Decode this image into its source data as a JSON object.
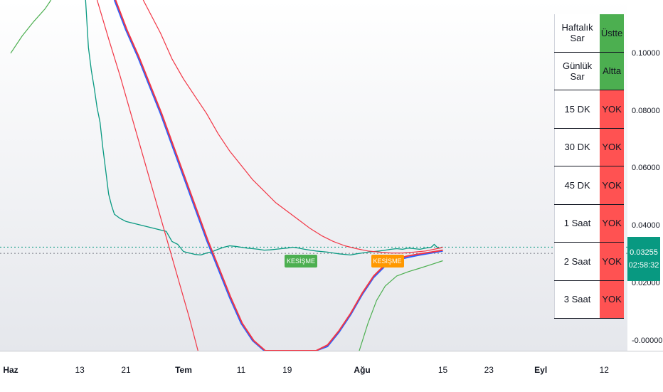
{
  "chart_data": {
    "type": "line",
    "y_ticks": [
      "0.10000",
      "0.08000",
      "0.06000",
      "0.04000",
      "0.02000",
      "-0.00000"
    ],
    "y_tick_values": [
      0.1,
      0.08,
      0.06,
      0.04,
      0.02,
      0.0
    ],
    "ylim": [
      -0.0035,
      0.1185
    ],
    "x_ticks": [
      {
        "label": "Haz",
        "day": 0,
        "major": true
      },
      {
        "label": "13",
        "day": 12,
        "major": false
      },
      {
        "label": "21",
        "day": 20,
        "major": false
      },
      {
        "label": "Tem",
        "day": 30,
        "major": true
      },
      {
        "label": "11",
        "day": 40,
        "major": false
      },
      {
        "label": "19",
        "day": 48,
        "major": false
      },
      {
        "label": "Ağu",
        "day": 61,
        "major": true
      },
      {
        "label": "15",
        "day": 75,
        "major": false
      },
      {
        "label": "23",
        "day": 83,
        "major": false
      },
      {
        "label": "Eyl",
        "day": 92,
        "major": true
      },
      {
        "label": "12",
        "day": 103,
        "major": false
      }
    ],
    "last_price": "0.03255",
    "countdown": "02:58:32",
    "grid": false,
    "series": [
      {
        "color": "#089981",
        "role": "price",
        "points": [
          [
            13,
            0.1185
          ],
          [
            13.5,
            0.102
          ],
          [
            14,
            0.094
          ],
          [
            14.5,
            0.088
          ],
          [
            15,
            0.081
          ],
          [
            15.5,
            0.076
          ],
          [
            16,
            0.067
          ],
          [
            16.5,
            0.059
          ],
          [
            17,
            0.051
          ],
          [
            17.5,
            0.047
          ],
          [
            18,
            0.044
          ],
          [
            19,
            0.0425
          ],
          [
            20,
            0.0415
          ],
          [
            21,
            0.041
          ],
          [
            22,
            0.0405
          ],
          [
            23,
            0.04
          ],
          [
            24,
            0.0395
          ],
          [
            25,
            0.039
          ],
          [
            26,
            0.0385
          ],
          [
            27,
            0.038
          ],
          [
            28,
            0.0345
          ],
          [
            29,
            0.0335
          ],
          [
            30,
            0.031
          ],
          [
            31,
            0.0305
          ],
          [
            32,
            0.03
          ],
          [
            33,
            0.0298
          ],
          [
            34,
            0.0305
          ],
          [
            35,
            0.031
          ],
          [
            36,
            0.0318
          ],
          [
            37,
            0.0325
          ],
          [
            38,
            0.033
          ],
          [
            39,
            0.0328
          ],
          [
            40,
            0.0325
          ],
          [
            41,
            0.0322
          ],
          [
            42,
            0.032
          ],
          [
            43,
            0.0318
          ],
          [
            44,
            0.0315
          ],
          [
            45,
            0.0316
          ],
          [
            46,
            0.0318
          ],
          [
            47,
            0.032
          ],
          [
            48,
            0.0322
          ],
          [
            49,
            0.0325
          ],
          [
            50,
            0.0322
          ],
          [
            51,
            0.0318
          ],
          [
            52,
            0.0315
          ],
          [
            53,
            0.0312
          ],
          [
            54,
            0.031
          ],
          [
            55,
            0.0308
          ],
          [
            56,
            0.0305
          ],
          [
            57,
            0.0302
          ],
          [
            58,
            0.03
          ],
          [
            59,
            0.0298
          ],
          [
            60,
            0.0302
          ],
          [
            61,
            0.0305
          ],
          [
            62,
            0.0308
          ],
          [
            63,
            0.031
          ],
          [
            64,
            0.0312
          ],
          [
            65,
            0.0315
          ],
          [
            66,
            0.0318
          ],
          [
            67,
            0.032
          ],
          [
            68,
            0.0318
          ],
          [
            69,
            0.0322
          ],
          [
            70,
            0.032
          ],
          [
            71,
            0.0318
          ],
          [
            72,
            0.0322
          ],
          [
            73,
            0.0325
          ],
          [
            73.5,
            0.0335
          ],
          [
            74,
            0.0325
          ],
          [
            74.5,
            0.0322
          ],
          [
            75,
            0.03255
          ]
        ]
      },
      {
        "color": "#f23645",
        "role": "ma-slow",
        "points": [
          [
            23,
            0.1185
          ],
          [
            26,
            0.107
          ],
          [
            28,
            0.098
          ],
          [
            30,
            0.091
          ],
          [
            32,
            0.085
          ],
          [
            34,
            0.079
          ],
          [
            36,
            0.072
          ],
          [
            38,
            0.066
          ],
          [
            40,
            0.061
          ],
          [
            42,
            0.056
          ],
          [
            44,
            0.052
          ],
          [
            46,
            0.048
          ],
          [
            48,
            0.045
          ],
          [
            50,
            0.042
          ],
          [
            52,
            0.039
          ],
          [
            54,
            0.0365
          ],
          [
            56,
            0.0345
          ],
          [
            58,
            0.033
          ],
          [
            60,
            0.032
          ],
          [
            62,
            0.0312
          ],
          [
            64,
            0.0308
          ],
          [
            66,
            0.0305
          ],
          [
            68,
            0.0305
          ],
          [
            70,
            0.0308
          ],
          [
            72,
            0.0312
          ],
          [
            74,
            0.032
          ],
          [
            75,
            0.0325
          ]
        ]
      },
      {
        "color": "#2962ff",
        "role": "ma-fast",
        "points": [
          [
            18,
            0.1185
          ],
          [
            20,
            0.108
          ],
          [
            22,
            0.099
          ],
          [
            24,
            0.089
          ],
          [
            26,
            0.079
          ],
          [
            28,
            0.068
          ],
          [
            30,
            0.057
          ],
          [
            32,
            0.046
          ],
          [
            34,
            0.035
          ],
          [
            36,
            0.025
          ],
          [
            38,
            0.015
          ],
          [
            40,
            0.006
          ],
          [
            42,
            0.0
          ],
          [
            44,
            -0.0035
          ],
          [
            53,
            -0.0035
          ],
          [
            55,
            -0.002
          ],
          [
            57,
            0.003
          ],
          [
            59,
            0.009
          ],
          [
            61,
            0.016
          ],
          [
            63,
            0.022
          ],
          [
            65,
            0.026
          ],
          [
            67,
            0.028
          ],
          [
            69,
            0.029
          ],
          [
            71,
            0.0298
          ],
          [
            73,
            0.0305
          ],
          [
            75,
            0.0312
          ]
        ]
      },
      {
        "color": "#f23645",
        "role": "ma-fast-2",
        "points": [
          [
            18.2,
            0.1185
          ],
          [
            20.2,
            0.108
          ],
          [
            22.2,
            0.099
          ],
          [
            24.2,
            0.089
          ],
          [
            26.2,
            0.079
          ],
          [
            28.2,
            0.068
          ],
          [
            30.2,
            0.057
          ],
          [
            32.2,
            0.046
          ],
          [
            34.2,
            0.035
          ],
          [
            36.2,
            0.025
          ],
          [
            38.2,
            0.015
          ],
          [
            40.2,
            0.006
          ],
          [
            42.2,
            0.0
          ],
          [
            44.2,
            -0.0035
          ],
          [
            53,
            -0.0035
          ],
          [
            55,
            -0.0015
          ],
          [
            57,
            0.0035
          ],
          [
            59,
            0.0095
          ],
          [
            61,
            0.0165
          ],
          [
            63,
            0.0225
          ],
          [
            65,
            0.0265
          ],
          [
            67,
            0.0285
          ],
          [
            69,
            0.0295
          ],
          [
            71,
            0.0302
          ],
          [
            73,
            0.0308
          ],
          [
            75,
            0.0315
          ]
        ]
      },
      {
        "color": "#f23645",
        "role": "band-low",
        "points": [
          [
            15,
            0.1185
          ],
          [
            17,
            0.105
          ],
          [
            19,
            0.092
          ],
          [
            21,
            0.078
          ],
          [
            23,
            0.064
          ],
          [
            25,
            0.05
          ],
          [
            27,
            0.036
          ],
          [
            29,
            0.022
          ],
          [
            31,
            0.008
          ],
          [
            32.5,
            -0.0035
          ]
        ]
      },
      {
        "color": "#4caf50",
        "role": "band-green",
        "points": [
          [
            0,
            0.1
          ],
          [
            2,
            0.106
          ],
          [
            4,
            0.111
          ],
          [
            6,
            0.1155
          ],
          [
            7,
            0.1185
          ]
        ]
      },
      {
        "color": "#4caf50",
        "role": "band-green-2",
        "points": [
          [
            60.5,
            -0.0035
          ],
          [
            62,
            0.006
          ],
          [
            63.5,
            0.014
          ],
          [
            65,
            0.019
          ],
          [
            67,
            0.0225
          ],
          [
            69,
            0.024
          ],
          [
            71,
            0.0252
          ],
          [
            73,
            0.0265
          ],
          [
            75,
            0.0278
          ]
        ]
      }
    ],
    "markers": [
      {
        "label": "KESİŞME",
        "day": 50,
        "value": 0.0284,
        "color": "#4caf50"
      },
      {
        "label": "KESİŞME",
        "day": 65,
        "value": 0.0284,
        "color": "#ff9800"
      }
    ]
  },
  "table": {
    "rows": [
      {
        "label": "Haftalık Sar",
        "value": "Üstte",
        "color": "#4caf50"
      },
      {
        "label": "Günlük Sar",
        "value": "Altta",
        "color": "#4caf50"
      },
      {
        "label": "15 DK",
        "value": "YOK",
        "color": "#ff5252"
      },
      {
        "label": "30 DK",
        "value": "YOK",
        "color": "#ff5252"
      },
      {
        "label": "45 DK",
        "value": "YOK",
        "color": "#ff5252"
      },
      {
        "label": "1 Saat",
        "value": "YOK",
        "color": "#ff5252"
      },
      {
        "label": "2 Saat",
        "value": "YOK",
        "color": "#ff5252"
      },
      {
        "label": "3 Saat",
        "value": "YOK",
        "color": "#ff5252"
      }
    ]
  }
}
